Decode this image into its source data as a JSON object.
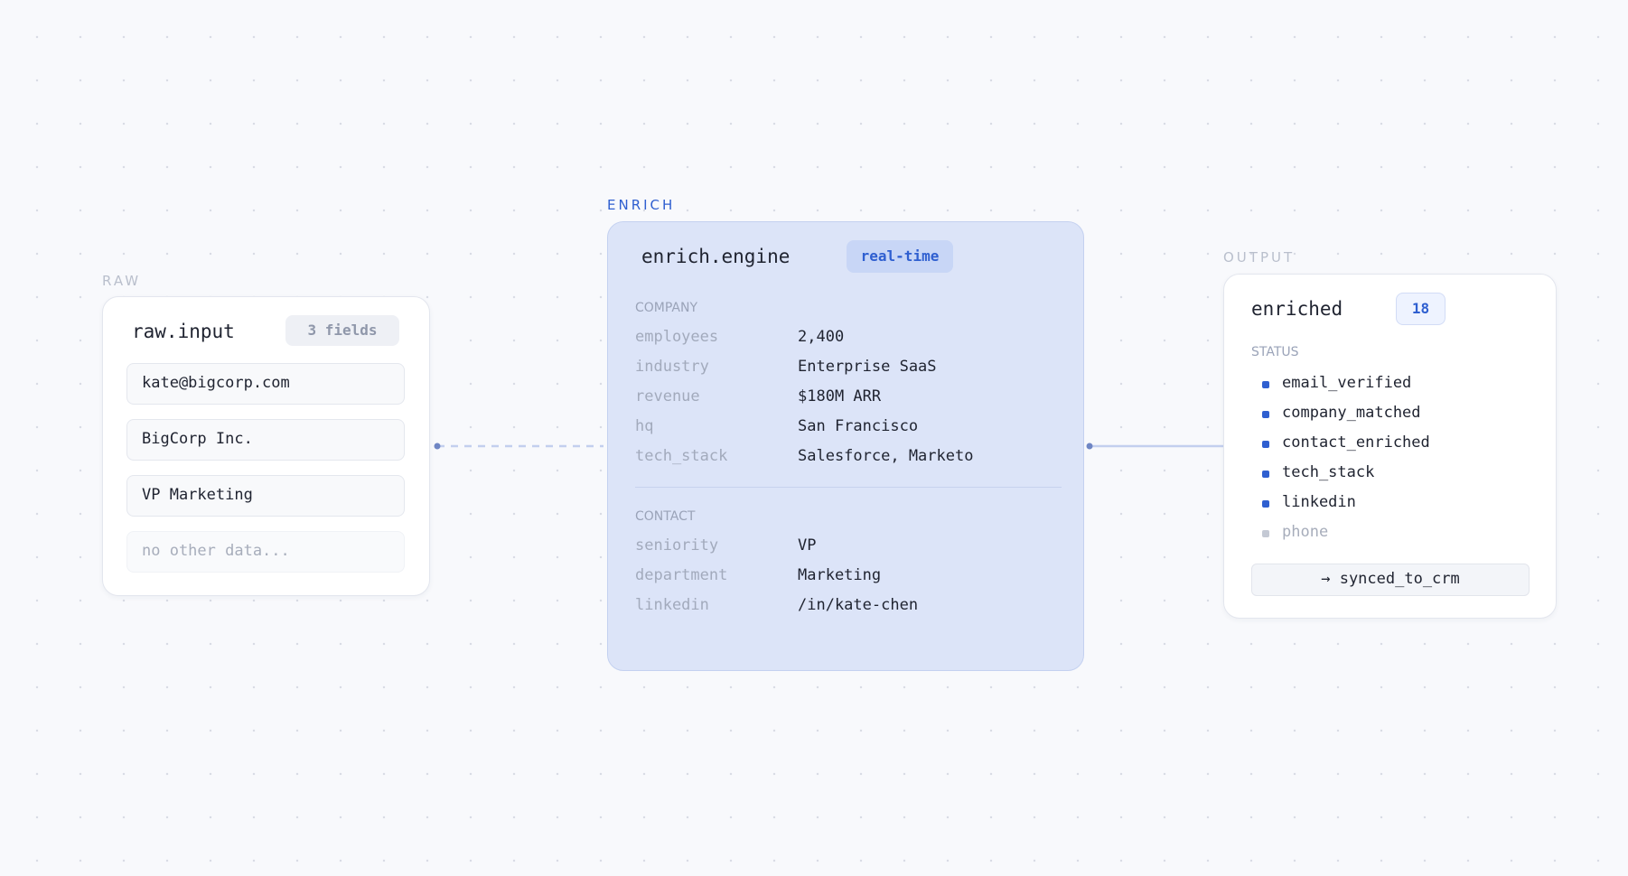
{
  "colors": {
    "accent": "#2f5fd0",
    "enrich_fill": "#dce4f8",
    "connector": "#c3cfee",
    "connector_dot": "#6f86c4",
    "inactive": "#c4c9d4"
  },
  "raw": {
    "section_label": "RAW",
    "title": "raw.input",
    "badge": "3 fields",
    "fields": [
      "kate@bigcorp.com",
      "BigCorp Inc.",
      "VP Marketing"
    ],
    "empty_placeholder": "no other data..."
  },
  "enrich": {
    "section_label": "ENRICH",
    "title": "enrich.engine",
    "badge": "real-time",
    "company": {
      "heading": "COMPANY",
      "rows": [
        {
          "key": "employees",
          "value": "2,400"
        },
        {
          "key": "industry",
          "value": "Enterprise SaaS"
        },
        {
          "key": "revenue",
          "value": "$180M ARR"
        },
        {
          "key": "hq",
          "value": "San Francisco"
        },
        {
          "key": "tech_stack",
          "value": "Salesforce, Marketo"
        }
      ]
    },
    "contact": {
      "heading": "CONTACT",
      "rows": [
        {
          "key": "seniority",
          "value": "VP"
        },
        {
          "key": "department",
          "value": "Marketing"
        },
        {
          "key": "linkedin",
          "value": "/in/kate-chen"
        }
      ]
    }
  },
  "output": {
    "section_label": "OUTPUT",
    "title": "enriched",
    "badge": "18",
    "status_heading": "STATUS",
    "status_items": [
      {
        "label": "email_verified",
        "active": true
      },
      {
        "label": "company_matched",
        "active": true
      },
      {
        "label": "contact_enriched",
        "active": true
      },
      {
        "label": "tech_stack",
        "active": true
      },
      {
        "label": "linkedin",
        "active": true
      },
      {
        "label": "phone",
        "active": false
      }
    ],
    "sync_button": "→ synced_to_crm"
  }
}
